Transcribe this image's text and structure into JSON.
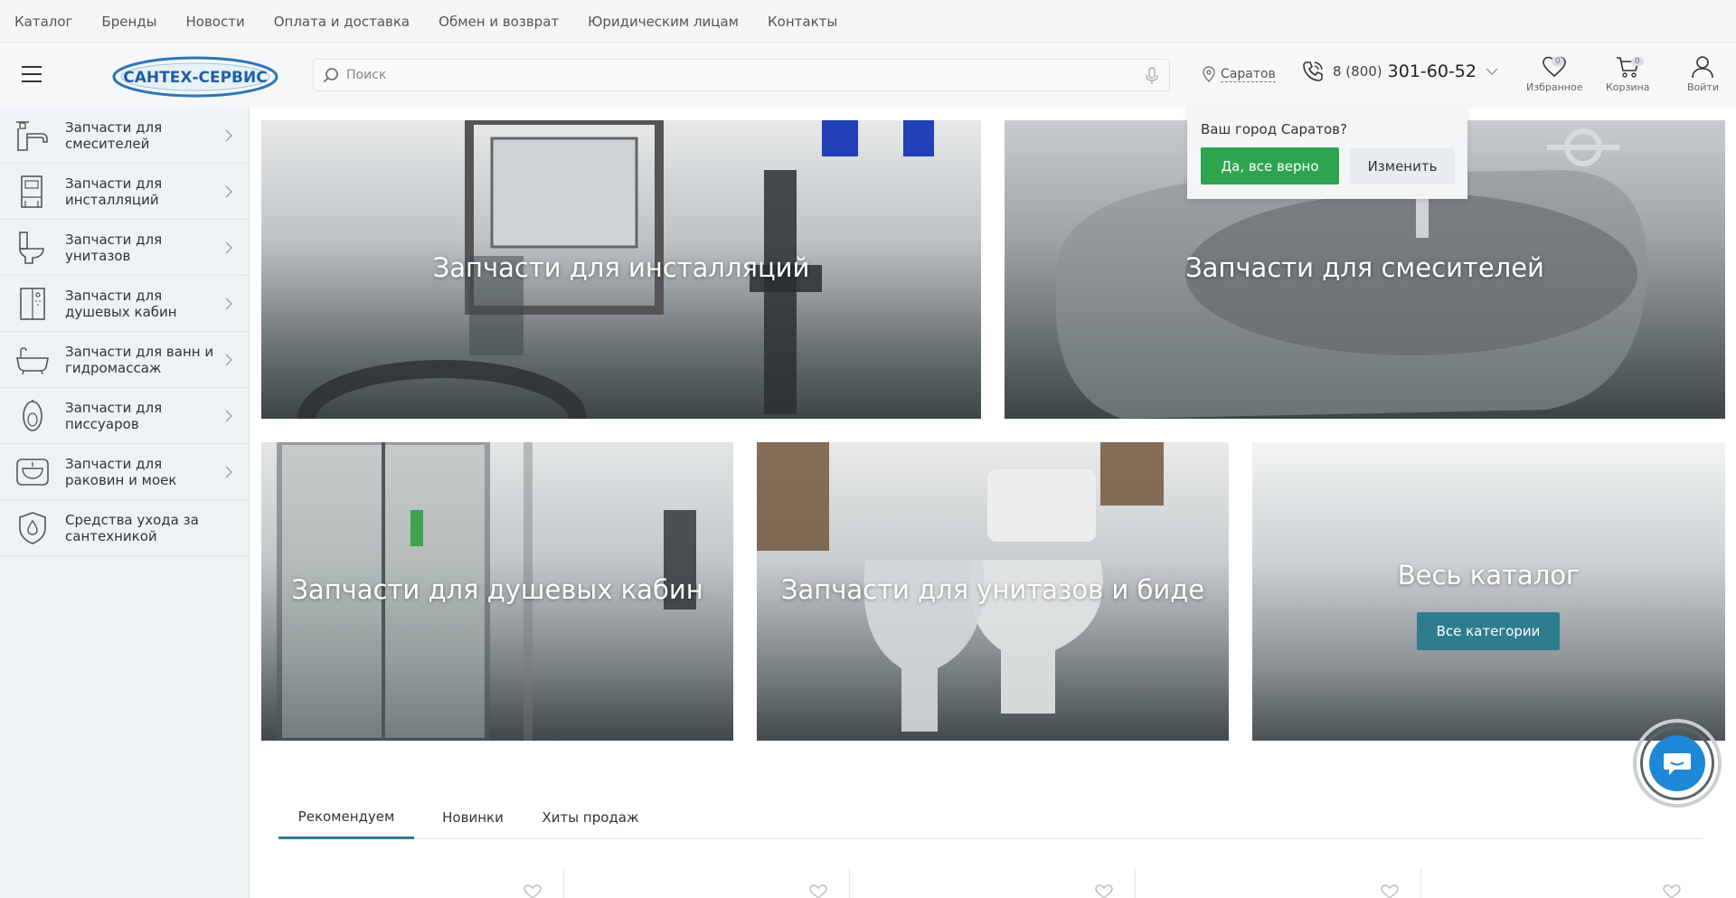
{
  "topnav": {
    "links": [
      "Каталог",
      "Бренды",
      "Новости",
      "Оплата и доставка",
      "Обмен и возврат",
      "Юридическим лицам",
      "Контакты"
    ]
  },
  "header": {
    "logo_text": "САНТЕХ-СЕРВИС",
    "search_placeholder": "Поиск",
    "city": "Саратов",
    "phone_prefix": "8 (800)",
    "phone_number": "301-60-52",
    "favorites_label": "Избранное",
    "favorites_count": "0",
    "cart_label": "Корзина",
    "cart_count": "0",
    "login_label": "Войти"
  },
  "sidebar": {
    "items": [
      {
        "label": "Запчасти для смесителей",
        "icon": "faucet-icon"
      },
      {
        "label": "Запчасти для инсталляций",
        "icon": "installation-icon"
      },
      {
        "label": "Запчасти для унитазов",
        "icon": "toilet-icon"
      },
      {
        "label": "Запчасти для душевых кабин",
        "icon": "shower-icon"
      },
      {
        "label": "Запчасти для ванн и гидромассаж",
        "icon": "bathtub-icon"
      },
      {
        "label": "Запчасти для писсуаров",
        "icon": "urinal-icon"
      },
      {
        "label": "Запчасти для раковин и моек",
        "icon": "sink-icon"
      },
      {
        "label": "Средства ухода за сантехникой",
        "icon": "care-icon"
      }
    ]
  },
  "tiles": {
    "installations": "Запчасти для инсталляций",
    "mixers": "Запчасти для смесителей",
    "showers": "Запчасти для душевых кабин",
    "toilets": "Запчасти для унитазов и биде",
    "catalog": "Весь каталог",
    "catalog_button": "Все категории"
  },
  "city_popup": {
    "question": "Ваш город Саратов?",
    "confirm": "Да, все верно",
    "change": "Изменить"
  },
  "tabs": [
    "Рекомендуем",
    "Новинки",
    "Хиты продаж"
  ],
  "colors": {
    "accent": "#2e7d8f",
    "confirm_green": "#2ea44f",
    "chat_blue": "#1e88d6"
  }
}
